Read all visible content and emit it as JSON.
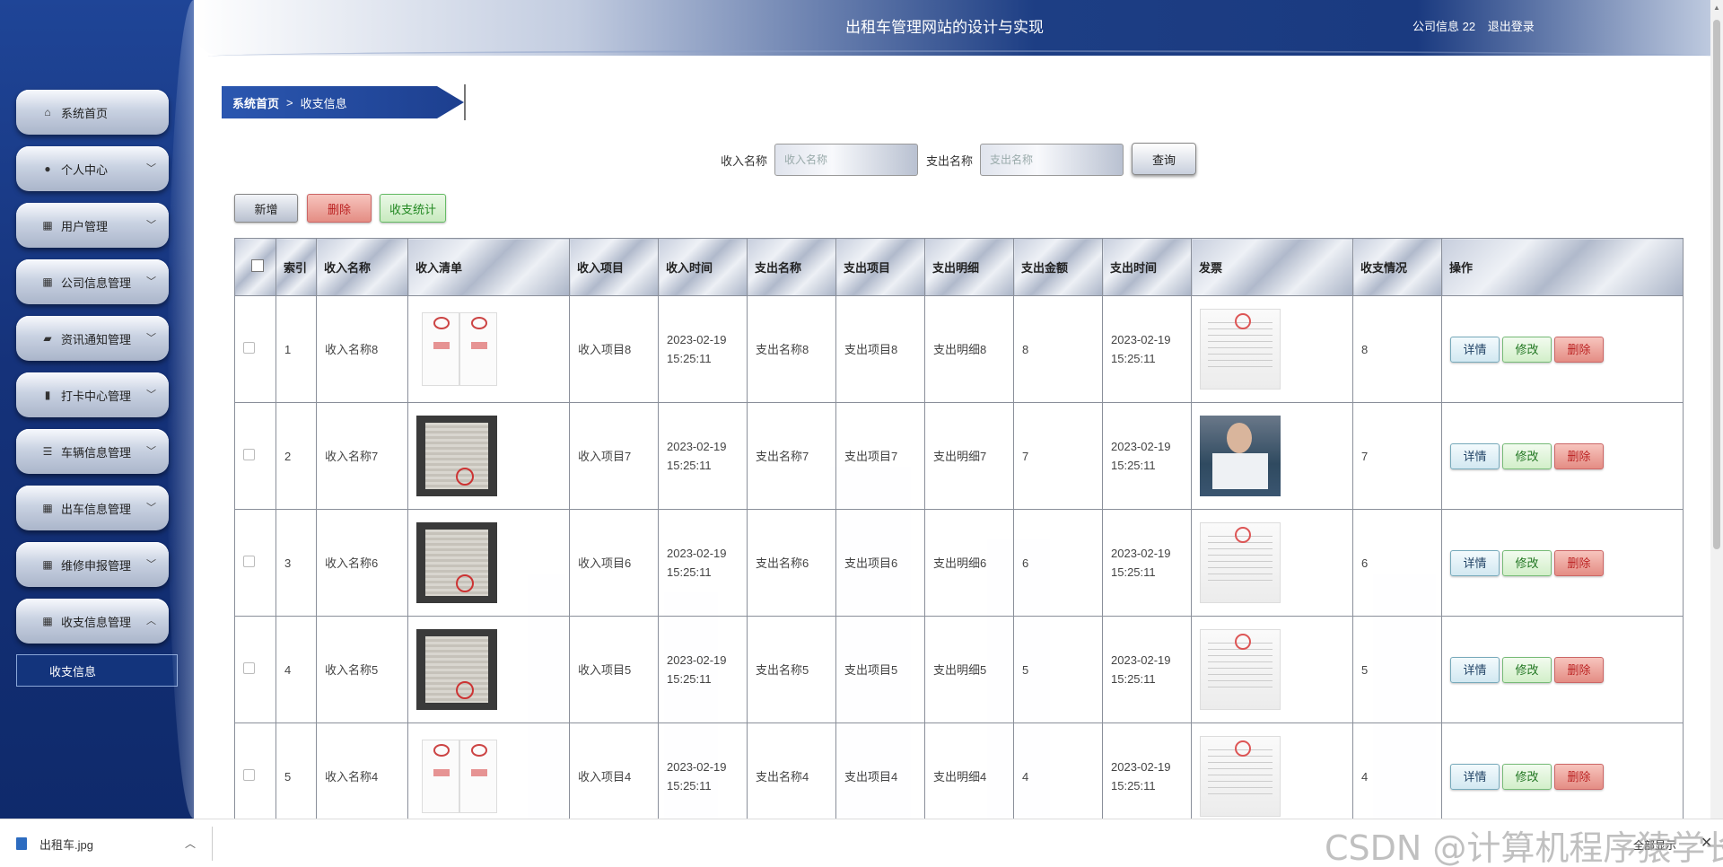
{
  "header": {
    "title": "出租车管理网站的设计与实现",
    "user_label": "公司信息 22",
    "logout": "退出登录"
  },
  "sidebar": {
    "items": [
      {
        "label": "系统首页",
        "icon": "home-icon",
        "expandable": false
      },
      {
        "label": "个人中心",
        "icon": "user-icon",
        "expandable": true
      },
      {
        "label": "用户管理",
        "icon": "grid-icon",
        "expandable": true
      },
      {
        "label": "公司信息管理",
        "icon": "grid-icon",
        "expandable": true
      },
      {
        "label": "资讯通知管理",
        "icon": "briefcase-icon",
        "expandable": true
      },
      {
        "label": "打卡中心管理",
        "icon": "bar-chart-icon",
        "expandable": true
      },
      {
        "label": "车辆信息管理",
        "icon": "sliders-icon",
        "expandable": true
      },
      {
        "label": "出车信息管理",
        "icon": "grid-icon",
        "expandable": true
      },
      {
        "label": "维修申报管理",
        "icon": "grid-icon",
        "expandable": true
      },
      {
        "label": "收支信息管理",
        "icon": "grid-icon",
        "expandable": true,
        "expanded": true
      }
    ],
    "submenu": {
      "label": "收支信息"
    }
  },
  "breadcrumb": {
    "home": "系统首页",
    "separator": ">",
    "current": "收支信息"
  },
  "search": {
    "income_label": "收入名称",
    "income_placeholder": "收入名称",
    "expense_label": "支出名称",
    "expense_placeholder": "支出名称",
    "query_button": "查询"
  },
  "actions": {
    "add": "新增",
    "delete": "删除",
    "stats": "收支统计"
  },
  "table": {
    "headers": [
      "索引",
      "收入名称",
      "收入清单",
      "收入项目",
      "收入时间",
      "支出名称",
      "支出项目",
      "支出明细",
      "支出金额",
      "支出时间",
      "发票",
      "收支情况",
      "操作"
    ],
    "ops": {
      "detail": "详情",
      "edit": "修改",
      "delete": "删除"
    },
    "rows": [
      {
        "index": "1",
        "income_name": "收入名称8",
        "income_list_img": "double-receipt",
        "income_item": "收入项目8",
        "income_time": "2023-02-19 15:25:11",
        "expense_name": "支出名称8",
        "expense_item": "支出项目8",
        "expense_detail": "支出明细8",
        "expense_amount": "8",
        "expense_time": "2023-02-19 15:25:11",
        "invoice_img": "paper",
        "balance": "8"
      },
      {
        "index": "2",
        "income_name": "收入名称7",
        "income_list_img": "dark",
        "income_item": "收入项目7",
        "income_time": "2023-02-19 15:25:11",
        "expense_name": "支出名称7",
        "expense_item": "支出项目7",
        "expense_detail": "支出明细7",
        "expense_amount": "7",
        "expense_time": "2023-02-19 15:25:11",
        "invoice_img": "photo",
        "balance": "7"
      },
      {
        "index": "3",
        "income_name": "收入名称6",
        "income_list_img": "dark",
        "income_item": "收入项目6",
        "income_time": "2023-02-19 15:25:11",
        "expense_name": "支出名称6",
        "expense_item": "支出项目6",
        "expense_detail": "支出明细6",
        "expense_amount": "6",
        "expense_time": "2023-02-19 15:25:11",
        "invoice_img": "paper",
        "balance": "6"
      },
      {
        "index": "4",
        "income_name": "收入名称5",
        "income_list_img": "dark",
        "income_item": "收入项目5",
        "income_time": "2023-02-19 15:25:11",
        "expense_name": "支出名称5",
        "expense_item": "支出项目5",
        "expense_detail": "支出明细5",
        "expense_amount": "5",
        "expense_time": "2023-02-19 15:25:11",
        "invoice_img": "paper",
        "balance": "5"
      },
      {
        "index": "5",
        "income_name": "收入名称4",
        "income_list_img": "double-receipt",
        "income_item": "收入项目4",
        "income_time": "2023-02-19 15:25:11",
        "expense_name": "支出名称4",
        "expense_item": "支出项目4",
        "expense_detail": "支出明细4",
        "expense_amount": "4",
        "expense_time": "2023-02-19 15:25:11",
        "invoice_img": "paper",
        "balance": "4"
      }
    ]
  },
  "download_bar": {
    "filename": "出租车.jpg",
    "show_all": "全部显示"
  },
  "watermark": "CSDN @计算机程序猿学长"
}
